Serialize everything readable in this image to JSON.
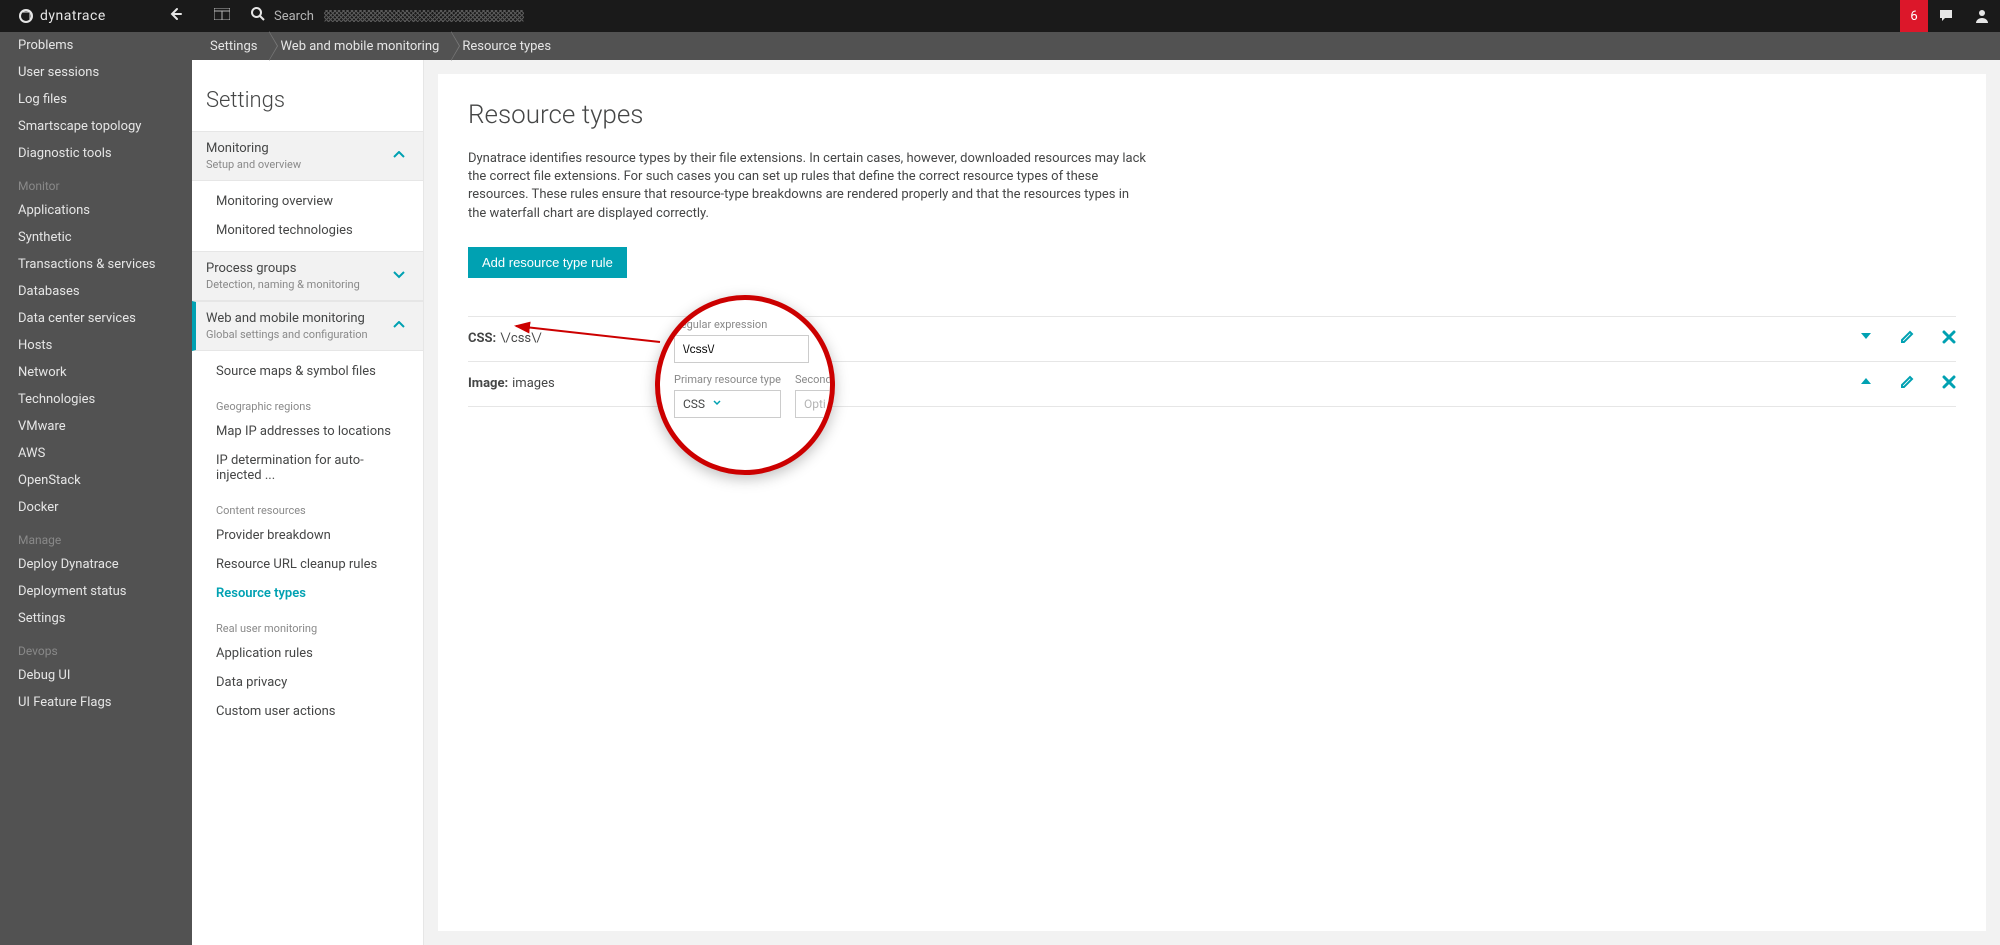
{
  "topbar": {
    "brand": "dynatrace",
    "search_label": "Search",
    "badge_count": "6"
  },
  "nav_primary": {
    "top": [
      "Problems",
      "User sessions",
      "Log files",
      "Smartscape topology",
      "Diagnostic tools"
    ],
    "monitor_heading": "Monitor",
    "monitor": [
      "Applications",
      "Synthetic",
      "Transactions & services",
      "Databases",
      "Data center services",
      "Hosts",
      "Network",
      "Technologies",
      "VMware",
      "AWS",
      "OpenStack",
      "Docker"
    ],
    "manage_heading": "Manage",
    "manage": [
      "Deploy Dynatrace",
      "Deployment status",
      "Settings"
    ],
    "devops_heading": "Devops",
    "devops": [
      "Debug UI",
      "UI Feature Flags"
    ]
  },
  "breadcrumbs": [
    "Settings",
    "Web and mobile monitoring",
    "Resource types"
  ],
  "nav_settings": {
    "title": "Settings",
    "groups": [
      {
        "title": "Monitoring",
        "sub": "Setup and overview",
        "open": true,
        "items": [
          "Monitoring overview",
          "Monitored technologies"
        ]
      },
      {
        "title": "Process groups",
        "sub": "Detection, naming & monitoring",
        "open": false
      },
      {
        "title": "Web and mobile monitoring",
        "sub": "Global settings and configuration",
        "open": true,
        "active": true,
        "sections": [
          {
            "items": [
              "Source maps & symbol files"
            ]
          },
          {
            "heading": "Geographic regions",
            "items": [
              "Map IP addresses to locations",
              "IP determination for auto-injected ..."
            ]
          },
          {
            "heading": "Content resources",
            "items": [
              "Provider breakdown",
              "Resource URL cleanup rules",
              "Resource types"
            ],
            "active_item": "Resource types"
          },
          {
            "heading": "Real user monitoring",
            "items": [
              "Application rules",
              "Data privacy",
              "Custom user actions"
            ]
          }
        ]
      }
    ]
  },
  "content": {
    "title": "Resource types",
    "description": "Dynatrace identifies resource types by their file extensions. In certain cases, however, downloaded resources may lack the correct file extensions. For such cases you can set up rules that define the correct resource types of these resources. These rules ensure that resource-type breakdowns are rendered properly and that the resources types in the waterfall chart are displayed correctly.",
    "add_button": "Add resource type rule",
    "rules": [
      {
        "name": "CSS:",
        "value": "\\/css\\/"
      },
      {
        "name": "Image:",
        "value": "images"
      }
    ]
  },
  "callout": {
    "regex_label": "Regular expression",
    "regex_value": "\\/css\\/",
    "primary_label": "Primary resource type",
    "secondary_label": "Secondary",
    "primary_value": "CSS",
    "secondary_placeholder": "Opti"
  }
}
